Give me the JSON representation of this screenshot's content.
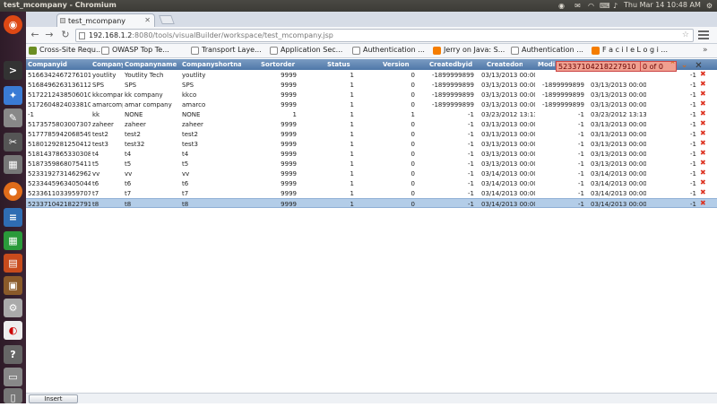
{
  "window": {
    "title": "test_mcompany - Chromium",
    "clock": "Thu Mar 14  10:48 AM"
  },
  "tab": {
    "label": "test_mcompany"
  },
  "address": {
    "host": "192.168.1.2",
    "path": ":8080/tools/visualBuilder/workspace/test_mcompany.jsp"
  },
  "bookmarks": [
    {
      "label": "Cross-Site Requ...",
      "icon": "puzzle-icon",
      "color": "#6b8e23"
    },
    {
      "label": "OWASP Top Te...",
      "icon": "page-icon",
      "color": "#777777"
    },
    {
      "label": "Transport Laye...",
      "icon": "page-icon",
      "color": "#777777"
    },
    {
      "label": "Application Sec...",
      "icon": "page-icon",
      "color": "#777777"
    },
    {
      "label": "Authentication ...",
      "icon": "page-icon",
      "color": "#777777"
    },
    {
      "label": "Jerry on Java: S...",
      "icon": "blogger-icon",
      "color": "#f57d00"
    },
    {
      "label": "Authentication ...",
      "icon": "page-icon",
      "color": "#777777"
    },
    {
      "label": "F a c i l e  L o g i ...",
      "icon": "blogger-icon",
      "color": "#f57d00"
    }
  ],
  "find": {
    "query": "523371042182279​10",
    "count": "0 of 0"
  },
  "grid": {
    "headers": [
      "Companyid",
      "Companyco",
      "Companyname",
      "Companyshortname",
      "Sortorder",
      "Status",
      "Version",
      "Createdbyid",
      "Createdon",
      "Modi",
      ""
    ],
    "rows": [
      [
        "51663424672761010",
        "youtlity",
        "Youtlity Tech",
        "youtlity",
        "9999",
        "1",
        "0",
        "-1899999899",
        "03/13/2013 00:00",
        "",
        ""
      ],
      [
        "51684962631361120",
        "SPS",
        "SPS",
        "SPS",
        "9999",
        "1",
        "0",
        "-1899999899",
        "03/13/2013 00:00",
        "-1899999899",
        "03/13/2013 00:00"
      ],
      [
        "51722124385060104",
        "kkcompany",
        "kk company",
        "kkco",
        "9999",
        "1",
        "0",
        "-1899999899",
        "03/13/2013 00:00",
        "-1899999899",
        "03/13/2013 00:00"
      ],
      [
        "51726048240338104",
        "amarcomp",
        "amar company",
        "amarco",
        "9999",
        "1",
        "0",
        "-1899999899",
        "03/13/2013 00:00",
        "-1899999899",
        "03/13/2013 00:00"
      ],
      [
        "-1",
        "kk",
        "NONE",
        "NONE",
        "1",
        "1",
        "1",
        "-1",
        "03/23/2012 13:13",
        "-1",
        "03/23/2012 13:13"
      ],
      [
        "51735758030073078",
        "zaheer",
        "zaheer",
        "zaheer",
        "9999",
        "1",
        "0",
        "-1",
        "03/13/2013 00:00",
        "-1",
        "03/13/2013 00:00"
      ],
      [
        "51777859420685496",
        "test2",
        "test2",
        "test2",
        "9999",
        "1",
        "0",
        "-1",
        "03/13/2013 00:00",
        "-1",
        "03/13/2013 00:00"
      ],
      [
        "51801292812504120",
        "test3",
        "test32",
        "test3",
        "9999",
        "1",
        "0",
        "-1",
        "03/13/2013 00:00",
        "-1",
        "03/13/2013 00:00"
      ],
      [
        "51814378653303086",
        "t4",
        "t4",
        "t4",
        "9999",
        "1",
        "0",
        "-1",
        "03/13/2013 00:00",
        "-1",
        "03/13/2013 00:00"
      ],
      [
        "51873598680754110",
        "t5",
        "t5",
        "t5",
        "9999",
        "1",
        "0",
        "-1",
        "03/13/2013 00:00",
        "-1",
        "03/13/2013 00:00"
      ],
      [
        "52331927314629620",
        "vv",
        "vv",
        "vv",
        "9999",
        "1",
        "0",
        "-1",
        "03/14/2013 00:00",
        "-1",
        "03/14/2013 00:00"
      ],
      [
        "52334459634050440",
        "t6",
        "t6",
        "t6",
        "9999",
        "1",
        "0",
        "-1",
        "03/14/2013 00:00",
        "-1",
        "03/14/2013 00:00"
      ],
      [
        "52336110339597070",
        "t7",
        "t7",
        "t7",
        "9999",
        "1",
        "0",
        "-1",
        "03/14/2013 00:00",
        "-1",
        "03/14/2013 00:00"
      ],
      [
        "52337104218227910",
        "t8",
        "t8",
        "t8",
        "9999",
        "1",
        "0",
        "-1",
        "03/14/2013 00:00",
        "-1",
        "03/14/2013 00:00"
      ]
    ],
    "trailing": [
      "-1",
      "-1",
      "-1",
      "-1",
      "-1",
      "-1",
      "-1",
      "-1",
      "-1",
      "-1",
      "-1",
      "-1",
      "-1",
      "-1"
    ],
    "selected_row": 13
  },
  "insert_button": "Insert"
}
